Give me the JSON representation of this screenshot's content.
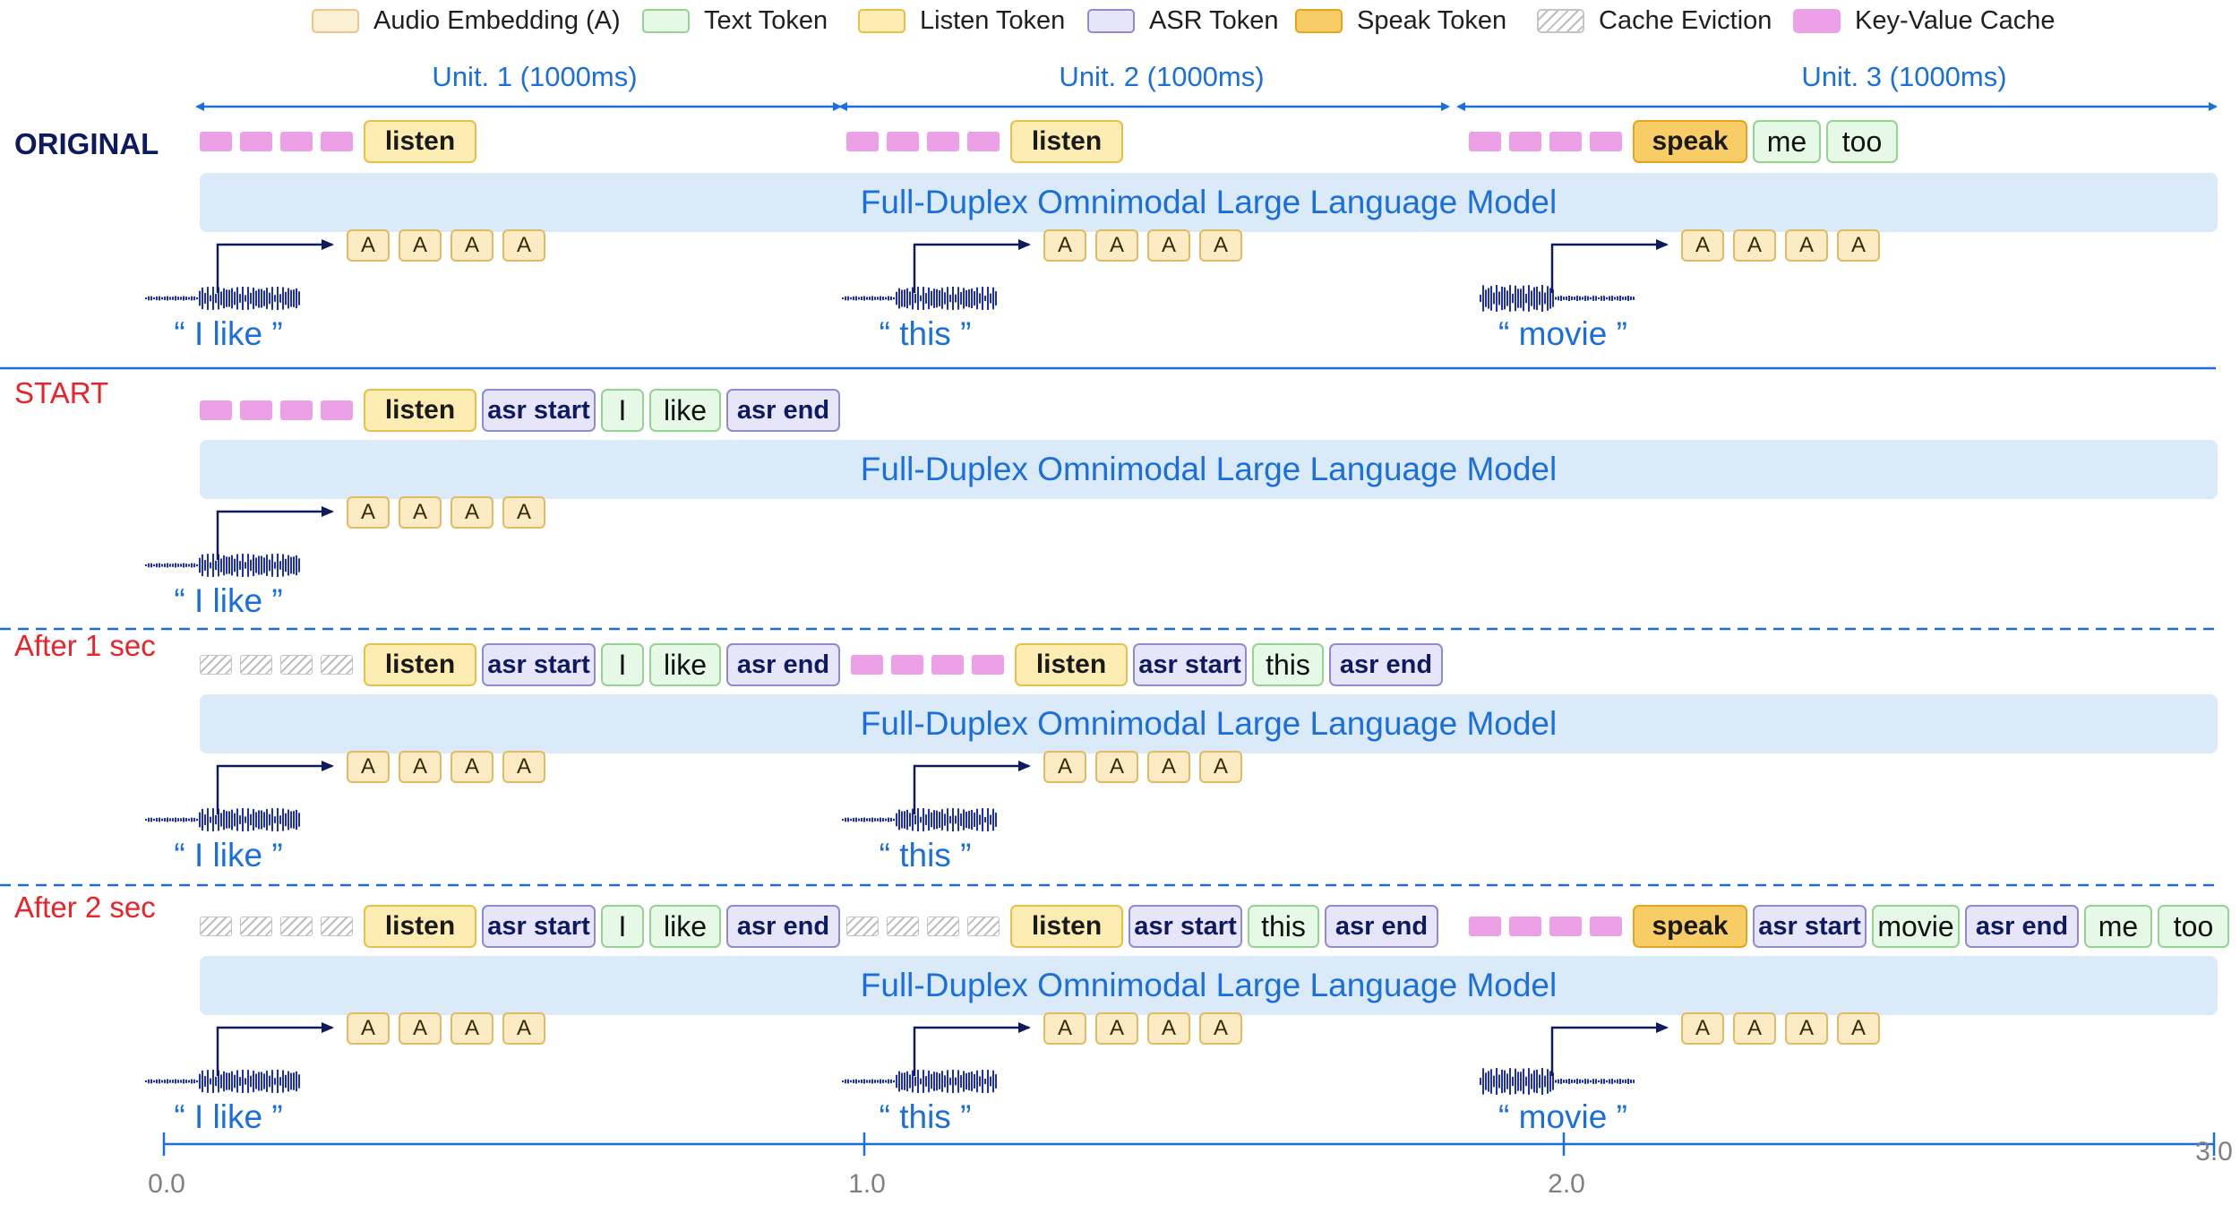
{
  "legend": [
    {
      "label": "Audio Embedding (A)",
      "fill": "#fcf0d4",
      "stroke": "#e8c98a",
      "pattern": "solid"
    },
    {
      "label": "Text Token",
      "fill": "#e6f8e6",
      "stroke": "#93d493",
      "pattern": "solid"
    },
    {
      "label": "Listen Token",
      "fill": "#fdedb2",
      "stroke": "#e8bf48",
      "pattern": "solid"
    },
    {
      "label": "ASR Token",
      "fill": "#e6e5f9",
      "stroke": "#8f8ad2",
      "pattern": "solid"
    },
    {
      "label": "Speak Token",
      "fill": "#f8cd66",
      "stroke": "#e6a521",
      "pattern": "solid"
    },
    {
      "label": "Cache Eviction",
      "fill": "#ffffff",
      "stroke": "#c4c4c4",
      "pattern": "hatch"
    },
    {
      "label": "Key-Value Cache",
      "fill": "#eca0e6",
      "stroke": "#eca0e6",
      "pattern": "solid"
    }
  ],
  "units": [
    {
      "label": "Unit. 1 (1000ms)"
    },
    {
      "label": "Unit. 2 (1000ms)"
    },
    {
      "label": "Unit. 3 (1000ms)"
    }
  ],
  "model_label": "Full-Duplex Omnimodal Large Language Model",
  "audio_embedding_label": "A",
  "quotes": [
    "“ I like ”",
    "“ this ”",
    "“ movie ”"
  ],
  "rows": [
    {
      "label": "ORIGINAL",
      "style": "orig",
      "groups": [
        {
          "cache": "kv",
          "tokens": [
            {
              "type": "listen",
              "text": "listen"
            }
          ]
        },
        {
          "cache": "kv",
          "tokens": [
            {
              "type": "listen",
              "text": "listen"
            }
          ]
        },
        {
          "cache": "kv",
          "tokens": [
            {
              "type": "speak",
              "text": "speak"
            },
            {
              "type": "text",
              "text": "me"
            },
            {
              "type": "text",
              "text": "too"
            }
          ]
        }
      ],
      "audio_segments": 3
    },
    {
      "label": "START",
      "style": "red",
      "groups": [
        {
          "cache": "kv",
          "tokens": [
            {
              "type": "listen",
              "text": "listen"
            },
            {
              "type": "asr",
              "text": "asr start"
            },
            {
              "type": "text",
              "text": "I"
            },
            {
              "type": "text",
              "text": "like"
            },
            {
              "type": "asr",
              "text": "asr end"
            }
          ]
        }
      ],
      "audio_segments": 1
    },
    {
      "label": "After 1 sec",
      "style": "red",
      "groups": [
        {
          "cache": "evicted",
          "tokens": [
            {
              "type": "listen",
              "text": "listen"
            },
            {
              "type": "asr",
              "text": "asr start"
            },
            {
              "type": "text",
              "text": "I"
            },
            {
              "type": "text",
              "text": "like"
            },
            {
              "type": "asr",
              "text": "asr end"
            }
          ]
        },
        {
          "cache": "kv",
          "tokens": [
            {
              "type": "listen",
              "text": "listen"
            },
            {
              "type": "asr",
              "text": "asr start"
            },
            {
              "type": "text",
              "text": "this"
            },
            {
              "type": "asr",
              "text": "asr end"
            }
          ]
        }
      ],
      "audio_segments": 2
    },
    {
      "label": "After 2 sec",
      "style": "red",
      "groups": [
        {
          "cache": "evicted",
          "tokens": [
            {
              "type": "listen",
              "text": "listen"
            },
            {
              "type": "asr",
              "text": "asr start"
            },
            {
              "type": "text",
              "text": "I"
            },
            {
              "type": "text",
              "text": "like"
            },
            {
              "type": "asr",
              "text": "asr end"
            }
          ]
        },
        {
          "cache": "evicted",
          "tokens": [
            {
              "type": "listen",
              "text": "listen"
            },
            {
              "type": "asr",
              "text": "asr start"
            },
            {
              "type": "text",
              "text": "this"
            },
            {
              "type": "asr",
              "text": "asr end"
            }
          ]
        },
        {
          "cache": "kv",
          "tokens": [
            {
              "type": "speak",
              "text": "speak"
            },
            {
              "type": "asr",
              "text": "asr start"
            },
            {
              "type": "text",
              "text": "movie"
            },
            {
              "type": "asr",
              "text": "asr end"
            },
            {
              "type": "text",
              "text": "me"
            },
            {
              "type": "text",
              "text": "too"
            }
          ]
        }
      ],
      "audio_segments": 3
    }
  ],
  "timeline": {
    "ticks": [
      "0.0",
      "1.0",
      "2.0",
      "3.0"
    ]
  },
  "colors": {
    "accent_blue": "#1b6fdc",
    "navy": "#0d1b5e",
    "red_label": "#e8242b",
    "model_bar": "#dbeaf8",
    "divider": "#1b6fdc"
  }
}
